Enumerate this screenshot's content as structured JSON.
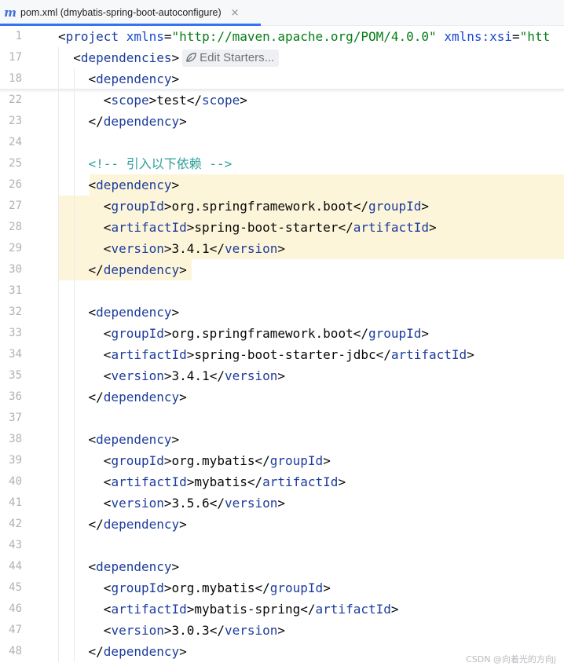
{
  "tab": {
    "icon": "m",
    "icon_name": "maven-icon",
    "title": "pom.xml (dmybatis-spring-boot-autoconfigure)",
    "close": "×"
  },
  "inlay": {
    "label": "Edit Starters..."
  },
  "lines": [
    {
      "n": "1",
      "text": "<project xmlns=\"http://maven.apache.org/POM/4.0.0\" xmlns:xsi=\"htt"
    },
    {
      "n": "17",
      "text": "  <dependencies>"
    },
    {
      "n": "18",
      "text": "    <dependency>"
    },
    {
      "n": "22",
      "text": "      <scope>test</scope>"
    },
    {
      "n": "23",
      "text": "    </dependency>"
    },
    {
      "n": "24",
      "text": ""
    },
    {
      "n": "25",
      "text": "    <!-- 引入以下依赖 -->"
    },
    {
      "n": "26",
      "text": "    <dependency>"
    },
    {
      "n": "27",
      "text": "      <groupId>org.springframework.boot</groupId>"
    },
    {
      "n": "28",
      "text": "      <artifactId>spring-boot-starter</artifactId>"
    },
    {
      "n": "29",
      "text": "      <version>3.4.1</version>"
    },
    {
      "n": "30",
      "text": "    </dependency>"
    },
    {
      "n": "31",
      "text": ""
    },
    {
      "n": "32",
      "text": "    <dependency>"
    },
    {
      "n": "33",
      "text": "      <groupId>org.springframework.boot</groupId>"
    },
    {
      "n": "34",
      "text": "      <artifactId>spring-boot-starter-jdbc</artifactId>"
    },
    {
      "n": "35",
      "text": "      <version>3.4.1</version>"
    },
    {
      "n": "36",
      "text": "    </dependency>"
    },
    {
      "n": "37",
      "text": ""
    },
    {
      "n": "38",
      "text": "    <dependency>"
    },
    {
      "n": "39",
      "text": "      <groupId>org.mybatis</groupId>"
    },
    {
      "n": "40",
      "text": "      <artifactId>mybatis</artifactId>"
    },
    {
      "n": "41",
      "text": "      <version>3.5.6</version>"
    },
    {
      "n": "42",
      "text": "    </dependency>"
    },
    {
      "n": "43",
      "text": ""
    },
    {
      "n": "44",
      "text": "    <dependency>"
    },
    {
      "n": "45",
      "text": "      <groupId>org.mybatis</groupId>"
    },
    {
      "n": "46",
      "text": "      <artifactId>mybatis-spring</artifactId>"
    },
    {
      "n": "47",
      "text": "      <version>3.0.3</version>"
    },
    {
      "n": "48",
      "text": "    </dependency>"
    }
  ],
  "highlighted_lines": [
    "26",
    "27",
    "28",
    "29",
    "30"
  ],
  "watermark": "CSDN @向着光的方向j",
  "colors": {
    "tag": "#1c3c9c",
    "attribute": "#174ad4",
    "string": "#067d17",
    "comment": "#2aa198",
    "highlight": "#fdf5d9",
    "tab_underline": "#3574f0"
  }
}
